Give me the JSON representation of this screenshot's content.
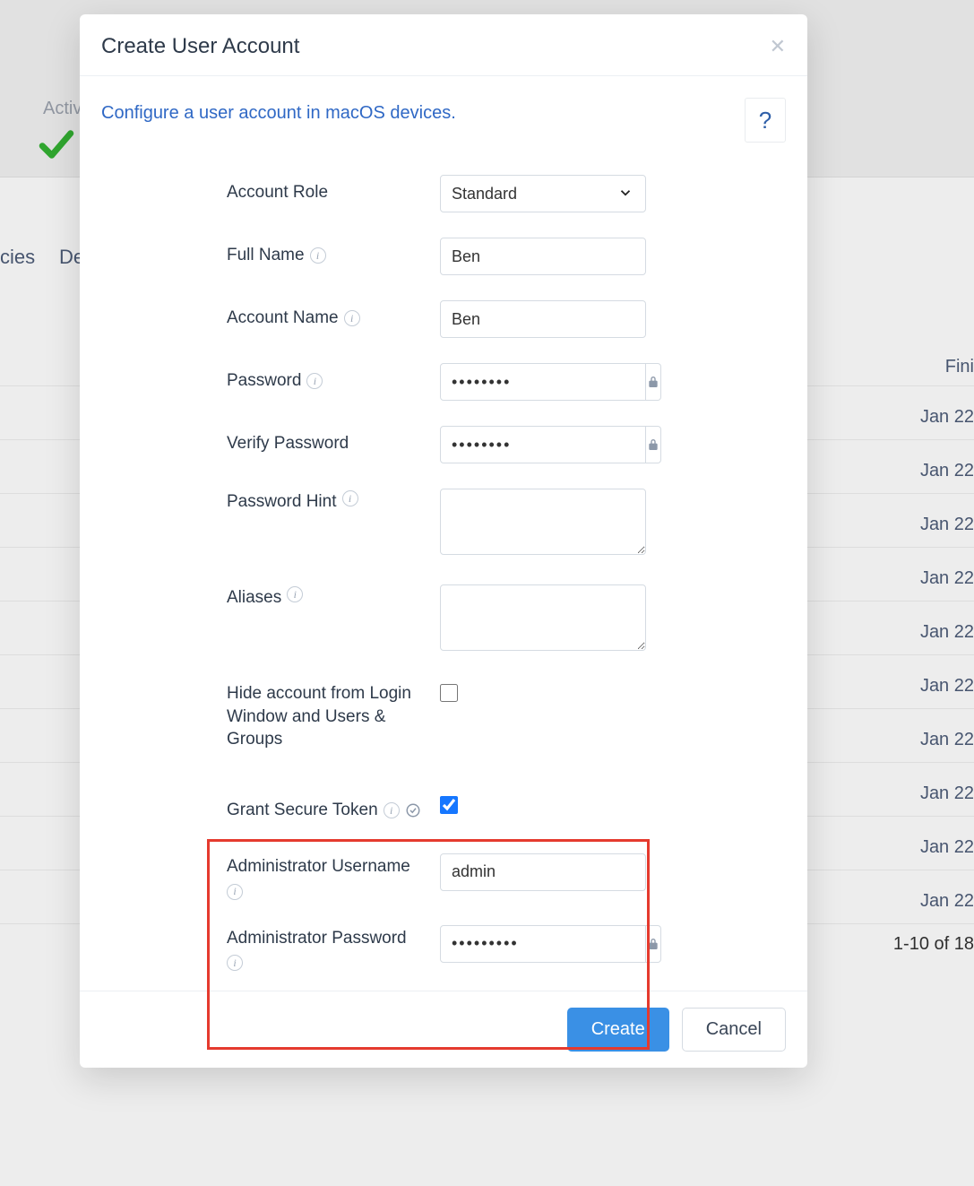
{
  "background": {
    "activ_fragment": "Activ",
    "tab_cies_fragment": "cies",
    "tab_de_fragment": "De",
    "fini_header_fragment": "Fini",
    "date_fragment": "Jan 22",
    "pager_text": "1-10 of 18"
  },
  "modal": {
    "title": "Create User Account",
    "subtitle": "Configure a user account in macOS devices.",
    "help_tooltip": "?",
    "form": {
      "account_role": {
        "label": "Account Role",
        "value": "Standard"
      },
      "full_name": {
        "label": "Full Name",
        "value": "Ben"
      },
      "account_name": {
        "label": "Account Name",
        "value": "Ben"
      },
      "password": {
        "label": "Password",
        "value": "••••••••"
      },
      "verify_password": {
        "label": "Verify Password",
        "value": "••••••••"
      },
      "password_hint": {
        "label": "Password Hint",
        "value": ""
      },
      "aliases": {
        "label": "Aliases",
        "value": ""
      },
      "hide_account": {
        "label": "Hide account from Login Window and Users & Groups",
        "checked": false
      },
      "grant_secure_token": {
        "label": "Grant Secure Token",
        "checked": true
      },
      "admin_username": {
        "label": "Administrator Username",
        "value": "admin"
      },
      "admin_password": {
        "label": "Administrator Password",
        "value": "•••••••••"
      }
    },
    "buttons": {
      "create": "Create",
      "cancel": "Cancel"
    }
  }
}
